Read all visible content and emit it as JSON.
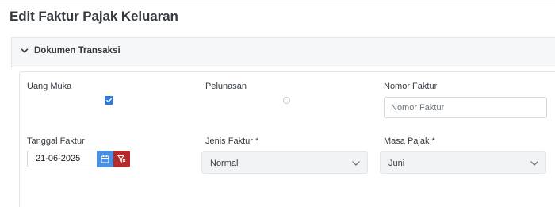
{
  "page": {
    "title": "Edit Faktur Pajak Keluaran"
  },
  "section": {
    "title": "Dokumen Transaksi",
    "expanded": true
  },
  "fields": {
    "uang_muka": {
      "label": "Uang Muka",
      "checked": true
    },
    "pelunasan": {
      "label": "Pelunasan",
      "checked": false
    },
    "nomor_faktur": {
      "label": "Nomor Faktur",
      "placeholder": "Nomor Faktur",
      "value": ""
    },
    "tanggal_faktur": {
      "label": "Tanggal Faktur",
      "value": "21-06-2025"
    },
    "jenis_faktur": {
      "label": "Jenis Faktur *",
      "value": "Normal"
    },
    "masa_pajak": {
      "label": "Masa Pajak *",
      "value": "Juni"
    }
  },
  "colors": {
    "accent": "#4a90e2",
    "checkbox": "#2f7ad9",
    "danger": "#b52a2a"
  },
  "icons": {
    "section_toggle": "chevron-down-icon",
    "calendar": "calendar-icon",
    "clear_filter": "filter-clear-icon",
    "select_caret": "chevron-down-icon"
  }
}
